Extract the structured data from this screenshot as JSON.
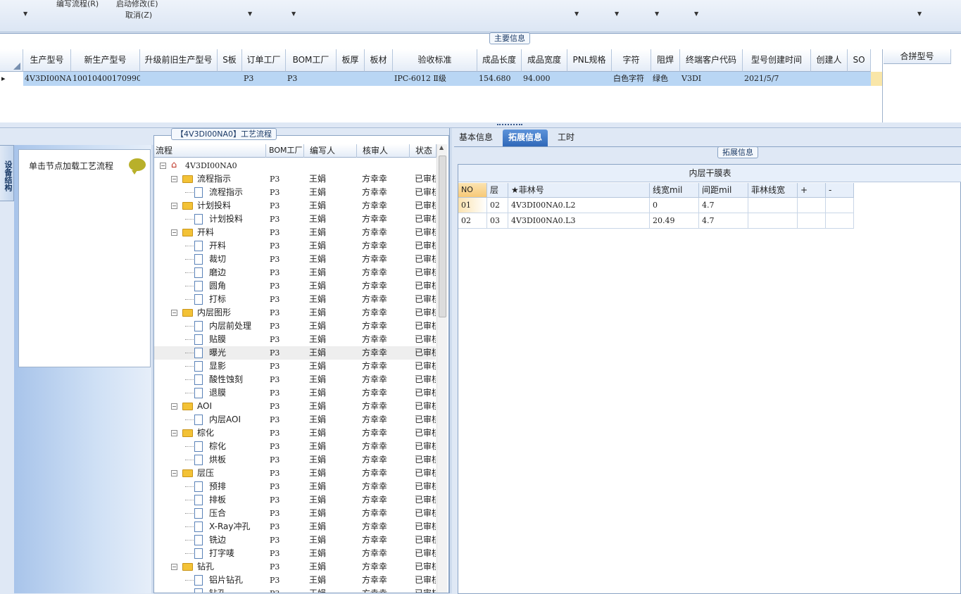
{
  "toolbar": {
    "items": [
      "编写流程(R)",
      "启动修改(E)",
      "取消(Z)"
    ]
  },
  "main_info": {
    "group_title": "主要信息",
    "columns": [
      "生产型号",
      "新生产型号",
      "升级前旧生产型号",
      "S板",
      "订单工厂",
      "BOM工厂",
      "板厚",
      "板材",
      "验收标准",
      "成品长度",
      "成品宽度",
      "PNL规格",
      "字符",
      "阻焊",
      "终端客户代码",
      "型号创建时间",
      "创建人",
      "SO"
    ],
    "row": [
      "4V3DI00NA0",
      "10010400170990",
      "",
      "",
      "P3",
      "P3",
      "",
      "",
      "IPC-6012 Ⅱ级",
      "154.680",
      "94.000",
      "",
      "白色字符",
      "绿色",
      "V3DI",
      "2021/5/7",
      "",
      ""
    ],
    "merge_header": "合拼型号"
  },
  "left_panel": {
    "vertical_tab": "设备结构",
    "hint": "单击节点加载工艺流程"
  },
  "process": {
    "group_title": "【4V3DI00NA0】工艺流程",
    "columns": [
      "流程",
      "BOM工厂",
      "编写人",
      "核审人",
      "状态"
    ],
    "root": "4V3DI00NA0",
    "rows": [
      {
        "name": "流程指示",
        "level": 1
      },
      {
        "name": "流程指示",
        "level": 2
      },
      {
        "name": "计划投料",
        "level": 1
      },
      {
        "name": "计划投料",
        "level": 2
      },
      {
        "name": "开料",
        "level": 1
      },
      {
        "name": "开料",
        "level": 2
      },
      {
        "name": "裁切",
        "level": 2
      },
      {
        "name": "磨边",
        "level": 2
      },
      {
        "name": "圆角",
        "level": 2
      },
      {
        "name": "打标",
        "level": 2
      },
      {
        "name": "内层图形",
        "level": 1
      },
      {
        "name": "内层前处理",
        "level": 2
      },
      {
        "name": "贴膜",
        "level": 2
      },
      {
        "name": "曝光",
        "level": 2
      },
      {
        "name": "显影",
        "level": 2
      },
      {
        "name": "酸性蚀刻",
        "level": 2
      },
      {
        "name": "退膜",
        "level": 2
      },
      {
        "name": "AOI",
        "level": 1
      },
      {
        "name": "内层AOI",
        "level": 2
      },
      {
        "name": "棕化",
        "level": 1
      },
      {
        "name": "棕化",
        "level": 2
      },
      {
        "name": "烘板",
        "level": 2
      },
      {
        "name": "层压",
        "level": 1
      },
      {
        "name": "预排",
        "level": 2
      },
      {
        "name": "排板",
        "level": 2
      },
      {
        "name": "压合",
        "level": 2
      },
      {
        "name": "X-Ray冲孔",
        "level": 2
      },
      {
        "name": "铣边",
        "level": 2
      },
      {
        "name": "打字唛",
        "level": 2
      },
      {
        "name": "钻孔",
        "level": 1
      },
      {
        "name": "铝片钻孔",
        "level": 2
      },
      {
        "name": "钻孔",
        "level": 2
      }
    ],
    "bom": "P3",
    "writer": "王娟",
    "reviewer": "方幸幸",
    "status": "已审核"
  },
  "right": {
    "tabs": [
      "基本信息",
      "拓展信息",
      "工时"
    ],
    "active_tab": "拓展信息",
    "group_title": "拓展信息",
    "table_title": "内层干膜表",
    "columns": [
      "NO",
      "层",
      "★菲林号",
      "线宽mil",
      "间距mil",
      "菲林线宽",
      "+",
      "-"
    ],
    "rows": [
      [
        "01",
        "02",
        "4V3DI00NA0.L2",
        "0",
        "4.7",
        "",
        "",
        ""
      ],
      [
        "02",
        "03",
        "4V3DI00NA0.L3",
        "20.49",
        "4.7",
        "",
        "",
        ""
      ]
    ]
  }
}
